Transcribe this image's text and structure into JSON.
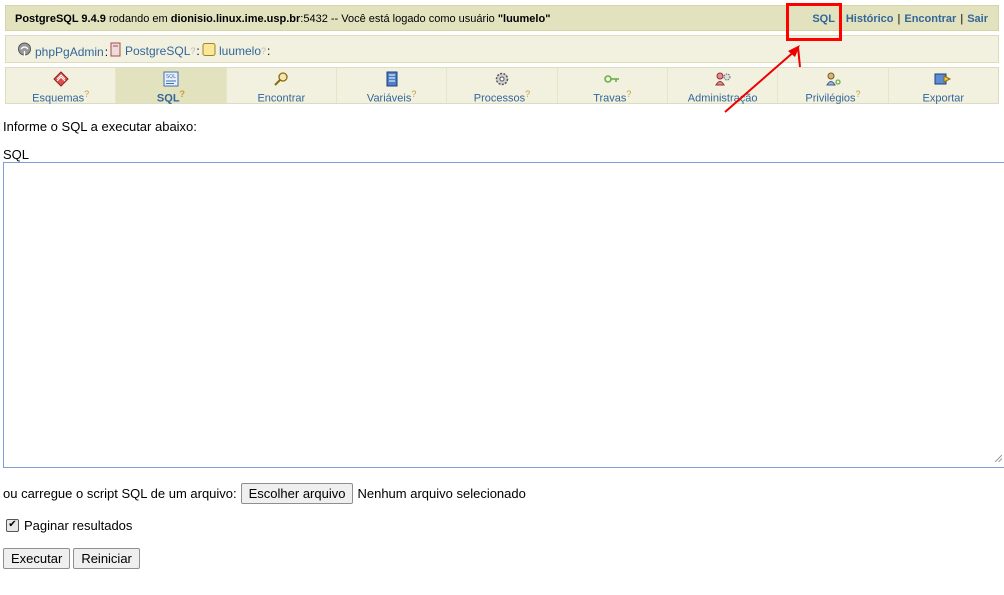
{
  "topbar": {
    "server_name": "PostgreSQL 9.4.9",
    "running_on": " rodando em ",
    "host": "dionisio.linux.ime.usp.br",
    "port": ":5432",
    "logged_text": " -- Você está logado como usuário ",
    "user": "\"luumelo\"",
    "links": {
      "sql": "SQL",
      "history": "Histórico",
      "find": "Encontrar",
      "logout": "Sair"
    }
  },
  "breadcrumb": {
    "app": "phpPgAdmin",
    "server": "PostgreSQL",
    "database": "luumelo",
    "help_mark": "?",
    "colon": ":"
  },
  "tabs": [
    {
      "label": "Esquemas",
      "icon": "schemas-icon",
      "help": "?"
    },
    {
      "label": "SQL",
      "icon": "sql-icon",
      "help": "?",
      "active": true
    },
    {
      "label": "Encontrar",
      "icon": "search-icon",
      "help": ""
    },
    {
      "label": "Variáveis",
      "icon": "variables-icon",
      "help": "?"
    },
    {
      "label": "Processos",
      "icon": "processes-icon",
      "help": "?"
    },
    {
      "label": "Travas",
      "icon": "locks-icon",
      "help": "?"
    },
    {
      "label": "Administração",
      "icon": "admin-icon",
      "help": ""
    },
    {
      "label": "Privilégios",
      "icon": "privileges-icon",
      "help": "?"
    },
    {
      "label": "Exportar",
      "icon": "export-icon",
      "help": ""
    }
  ],
  "form": {
    "prompt": "Informe o SQL a executar abaixo:",
    "sql_label": "SQL",
    "sql_value": "",
    "upload_label": "ou carregue o script SQL de um arquivo:",
    "file_button": "Escolher arquivo",
    "no_file": "Nenhum arquivo selecionado",
    "paginate_label": "Paginar resultados",
    "paginate_checked": true,
    "execute_button": "Executar",
    "reset_button": "Reiniciar"
  },
  "colors": {
    "topbar_bg": "#e3e2bf",
    "link": "#336699",
    "annotation": "#ff0000"
  }
}
